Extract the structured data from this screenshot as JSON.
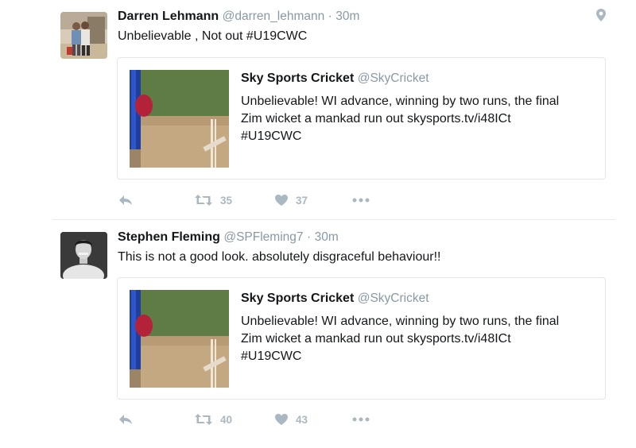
{
  "tweets": [
    {
      "author_name": "Darren Lehmann",
      "author_handle": "@darren_lehmann",
      "separator": "·",
      "time": "30m",
      "text": "Unbelievable , Not out #U19CWC",
      "quoted": {
        "name": "Sky Sports Cricket",
        "handle": "@SkyCricket",
        "lines": [
          "Unbelievable! WI advance, winning by two runs, the final",
          "Zim wicket a mankad run out skysports.tv/i48ICt",
          "#U19CWC"
        ]
      },
      "retweets": "35",
      "likes": "37"
    },
    {
      "author_name": "Stephen Fleming",
      "author_handle": "@SPFleming7",
      "separator": "·",
      "time": "30m",
      "text": "This is not a good look. absolutely disgraceful behaviour!!",
      "quoted": {
        "name": "Sky Sports Cricket",
        "handle": "@SkyCricket",
        "lines": [
          "Unbelievable! WI advance, winning by two runs, the final",
          "Zim wicket a mankad run out skysports.tv/i48ICt",
          "#U19CWC"
        ]
      },
      "retweets": "40",
      "likes": "43"
    }
  ],
  "icons": {
    "reply": "reply-icon",
    "retweet": "retweet-icon",
    "like": "heart-icon",
    "more": "more-icon",
    "location": "location-pin-icon"
  },
  "colors": {
    "action_gray": "#aab8c2",
    "meta_gray": "#8899a6",
    "text": "#14171a",
    "border": "#e1e8ed"
  }
}
